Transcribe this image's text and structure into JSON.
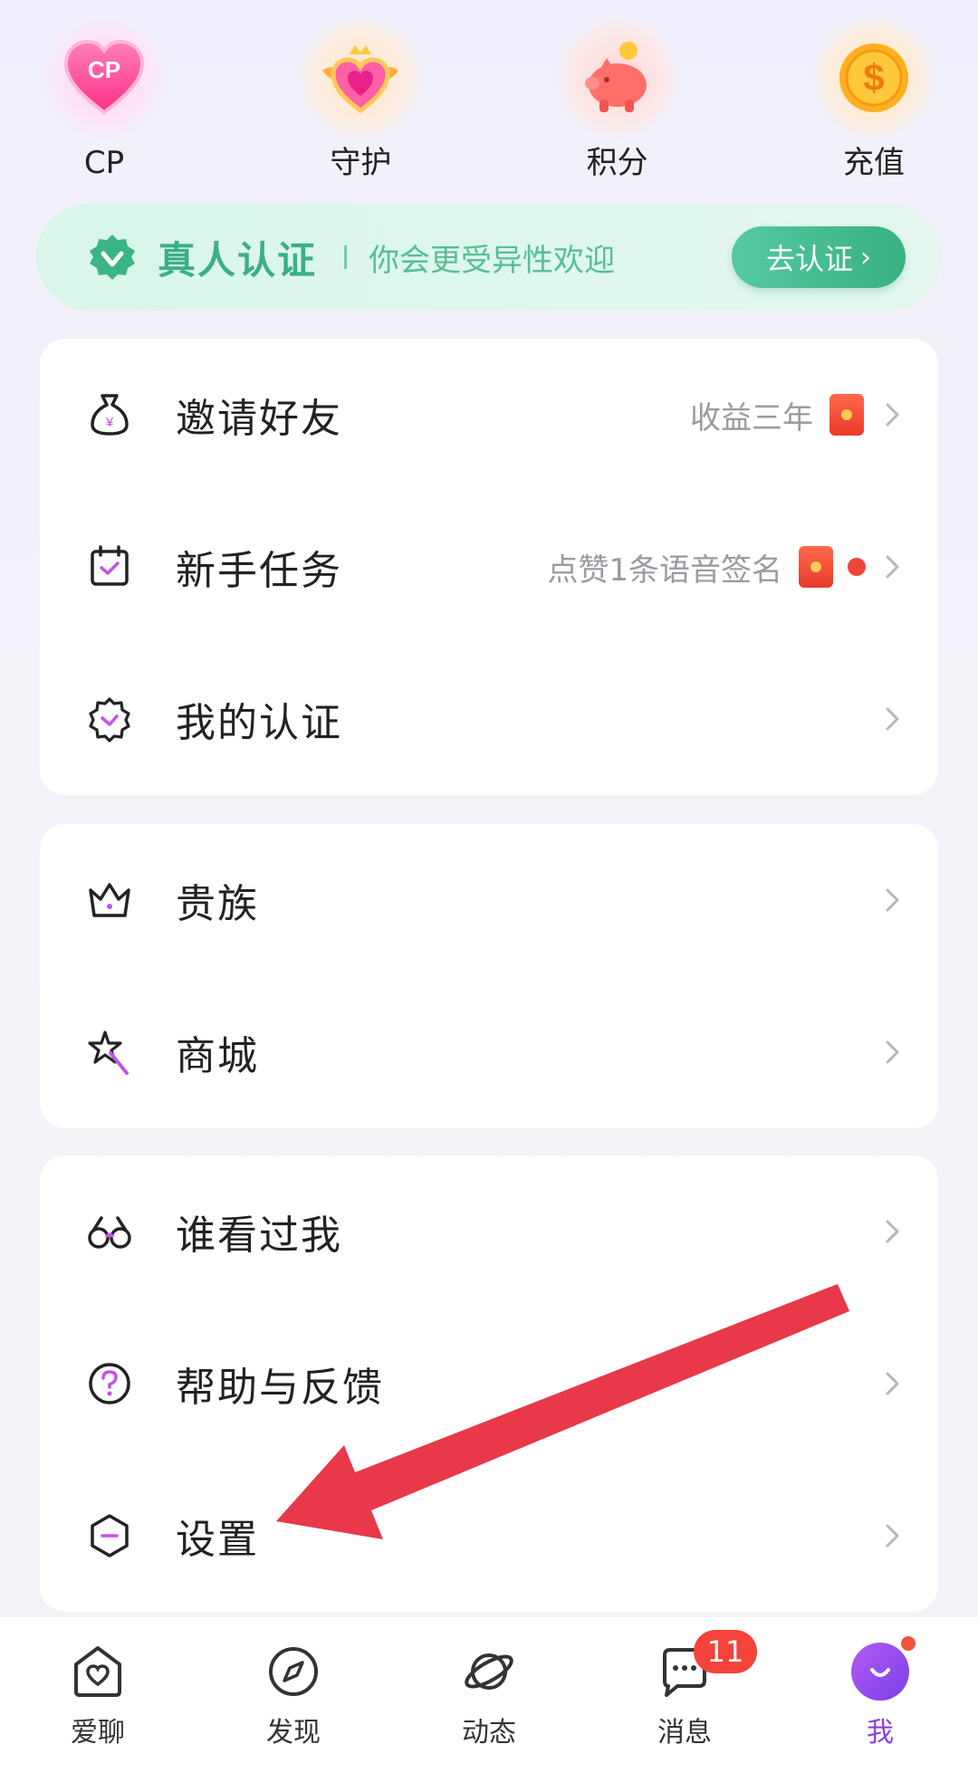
{
  "quick_actions": [
    {
      "label": "CP",
      "icon": "cp-heart-icon"
    },
    {
      "label": "守护",
      "icon": "guard-crown-heart-icon"
    },
    {
      "label": "积分",
      "icon": "piggy-bank-icon"
    },
    {
      "label": "充值",
      "icon": "dollar-coin-icon"
    }
  ],
  "verify_banner": {
    "title": "真人认证",
    "subtitle": "你会更受异性欢迎",
    "button": "去认证",
    "accent": "#3aaf85"
  },
  "menu_group_1": [
    {
      "label": "邀请好友",
      "extra": "收益三年",
      "icon": "money-bag-icon"
    },
    {
      "label": "新手任务",
      "extra": "点赞1条语音签名",
      "icon": "calendar-check-icon"
    },
    {
      "label": "我的认证",
      "extra": "",
      "icon": "badge-check-icon"
    }
  ],
  "menu_group_2": [
    {
      "label": "贵族",
      "icon": "crown-icon"
    },
    {
      "label": "商城",
      "icon": "magic-wand-star-icon"
    }
  ],
  "menu_group_3": [
    {
      "label": "谁看过我",
      "icon": "glasses-icon"
    },
    {
      "label": "帮助与反馈",
      "icon": "question-circle-icon"
    },
    {
      "label": "设置",
      "icon": "hexagon-settings-icon"
    }
  ],
  "bottom_nav": [
    {
      "label": "爱聊",
      "icon": "home-heart-icon"
    },
    {
      "label": "发现",
      "icon": "compass-icon"
    },
    {
      "label": "动态",
      "icon": "planet-icon"
    },
    {
      "label": "消息",
      "icon": "chat-bubble-icon",
      "badge": "11"
    },
    {
      "label": "我",
      "icon": "me-avatar-icon",
      "active": true
    }
  ],
  "colors": {
    "accent_purple": "#8b3fe0",
    "badge_red": "#f4433a",
    "arrow_red": "#e8384a"
  }
}
